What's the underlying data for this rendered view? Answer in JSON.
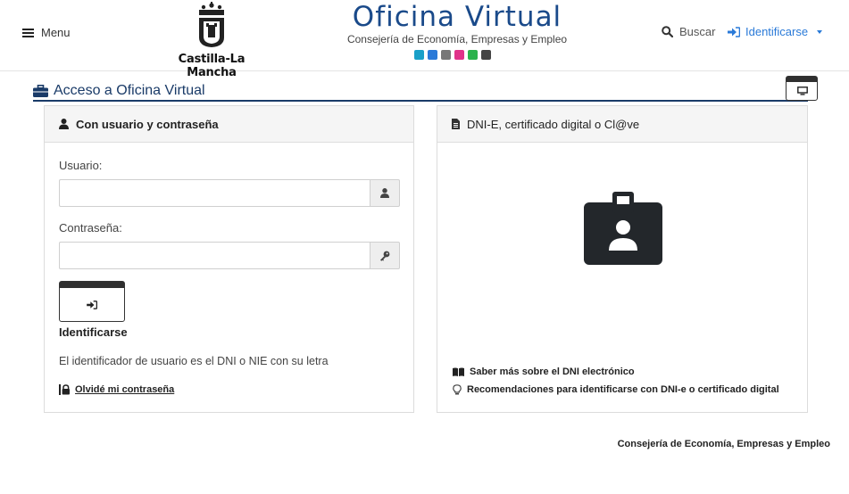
{
  "header": {
    "menu_label": "Menu",
    "logo_text": "Castilla-La Mancha",
    "brand_title": "Oficina Virtual",
    "brand_subtitle": "Consejería de Economía, Empresas y Empleo",
    "search_label": "Buscar",
    "login_label": "Identificarse",
    "brand_icons": [
      {
        "name": "id-card-icon",
        "color": "#1aa0c8"
      },
      {
        "name": "megaphone-icon",
        "color": "#2a7ad8"
      },
      {
        "name": "user-tie-icon",
        "color": "#777777"
      },
      {
        "name": "list-icon",
        "color": "#e0338a"
      },
      {
        "name": "clipboard-icon",
        "color": "#2bb24c"
      },
      {
        "name": "gears-icon",
        "color": "#444444"
      }
    ]
  },
  "section": {
    "title": "Acceso a Oficina Virtual"
  },
  "left_panel": {
    "heading": "Con usuario y contraseña",
    "user_label": "Usuario:",
    "user_value": "",
    "password_label": "Contraseña:",
    "password_value": "",
    "button_caption": "Identificarse",
    "hint": "El identificador de usuario es el DNI o NIE con su letra",
    "forgot_label": "Olvidé mi contraseña"
  },
  "right_panel": {
    "heading": "DNI-E, certificado digital o Cl@ve",
    "link_dni": "Saber más sobre el DNI electrónico",
    "link_recommendations": "Recomendaciones para identificarse con DNI-e o certificado digital"
  },
  "footer": {
    "text": "Consejería de Economía, Empresas y Empleo"
  },
  "colors": {
    "brand_blue": "#1a4a8a",
    "link_blue": "#2a7ad8",
    "section_navy": "#1a3b68",
    "dark": "#2f2f2f"
  }
}
